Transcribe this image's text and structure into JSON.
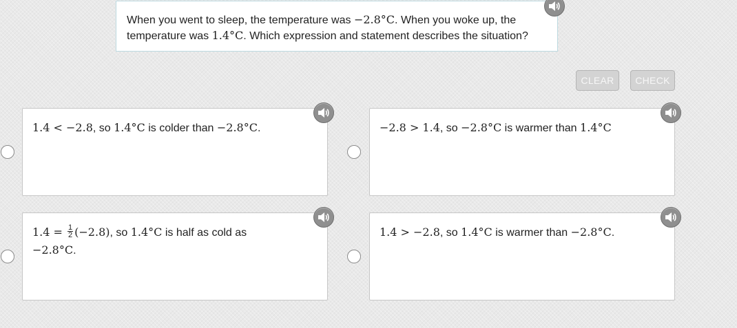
{
  "prompt": {
    "t1": "When you went to sleep, the temperature was ",
    "m1": "−2.8°C",
    "t2": ". When you woke up, the",
    "t3": "temperature was ",
    "m2": "1.4°C",
    "t4": ". Which expression and statement describes the situation?"
  },
  "buttons": {
    "clear": "CLEAR",
    "check": "CHECK"
  },
  "choices": {
    "a": {
      "m1": "1.4 < −2.8",
      "t1": ", so ",
      "m2": "1.4°C",
      "t2": " is colder than ",
      "m3": "−2.8°C",
      "t3": "."
    },
    "b": {
      "m1": "−2.8 > 1.4",
      "t1": ", so ",
      "m2": "−2.8°C",
      "t2": " is warmer than ",
      "m3": "1.4°C"
    },
    "c": {
      "m1": "1.4 = ",
      "frac_num": "1",
      "frac_den": "2",
      "m2": "(−2.8)",
      "t1": ", so ",
      "m3": "1.4°C",
      "t2": " is half as cold as",
      "m4": "−2.8°C",
      "t3": "."
    },
    "d": {
      "m1": "1.4 > −2.8",
      "t1": ", so ",
      "m2": "1.4°C",
      "t2": " is warmer than ",
      "m3": "−2.8°C",
      "t3": "."
    }
  },
  "icons": {
    "audio": "speaker-icon",
    "radio": "radio-button"
  },
  "colors": {
    "audio_button": "#8f8f8f",
    "prompt_border": "#bcd9e0",
    "disabled_button": "#d3d3d3"
  }
}
